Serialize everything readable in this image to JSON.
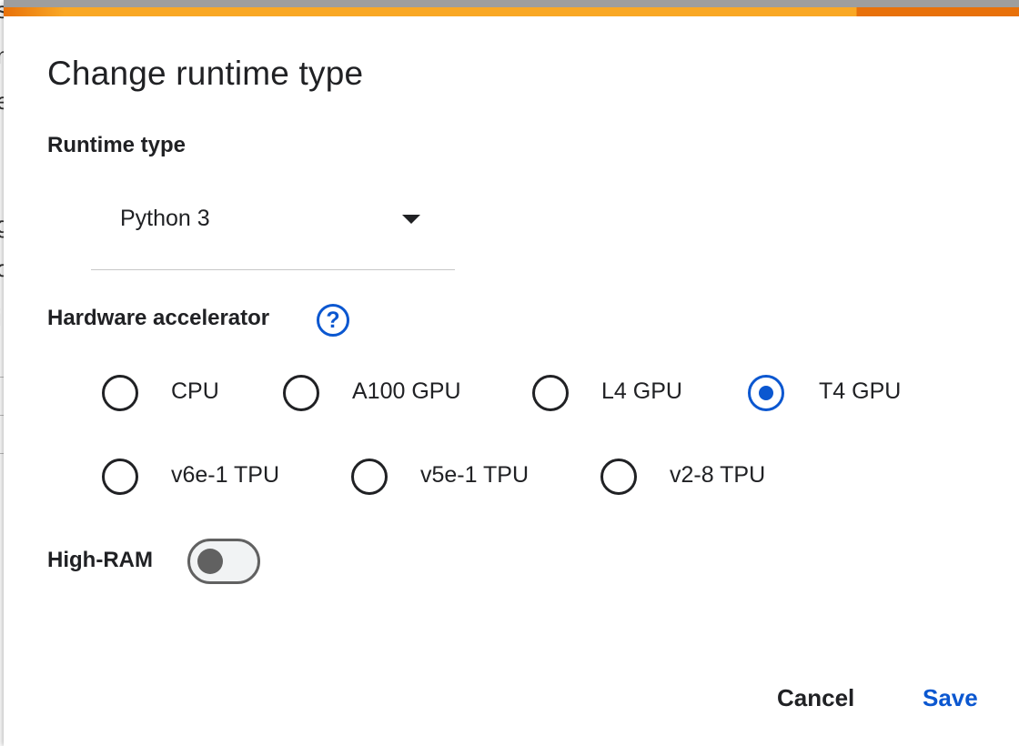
{
  "dialog": {
    "title": "Change runtime type",
    "runtime_type": {
      "label": "Runtime type",
      "selected": "Python 3"
    },
    "hardware_accelerator": {
      "label": "Hardware accelerator",
      "help_icon": "help-circle-icon",
      "options": [
        {
          "label": "CPU",
          "checked": false
        },
        {
          "label": "A100 GPU",
          "checked": false
        },
        {
          "label": "L4 GPU",
          "checked": false
        },
        {
          "label": "T4 GPU",
          "checked": true
        },
        {
          "label": "v6e-1 TPU",
          "checked": false
        },
        {
          "label": "v5e-1 TPU",
          "checked": false
        },
        {
          "label": "v2-8 TPU",
          "checked": false
        }
      ]
    },
    "high_ram": {
      "label": "High-RAM",
      "enabled": false
    },
    "buttons": {
      "cancel": "Cancel",
      "save": "Save"
    }
  },
  "colors": {
    "accent": "#0b57d0",
    "top_bar": "#f9a825",
    "top_bar_edge": "#e8710a"
  }
}
